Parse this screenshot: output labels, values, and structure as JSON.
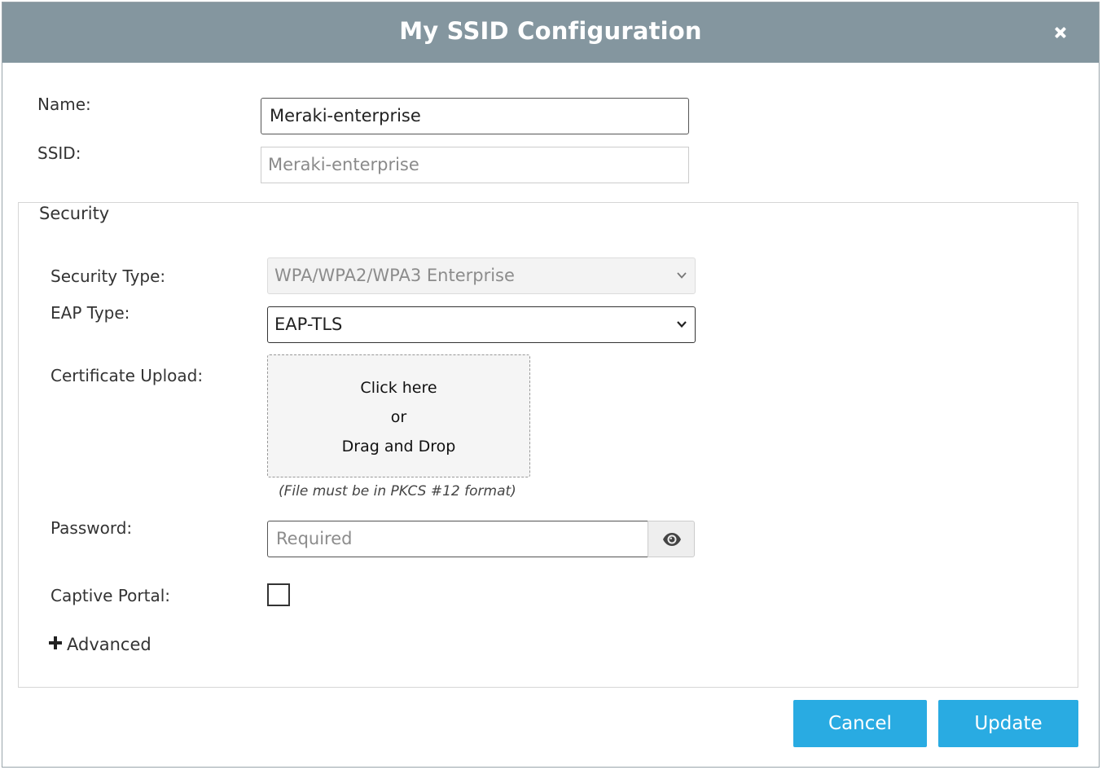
{
  "dialog": {
    "title": "My SSID Configuration",
    "close_icon": "close-icon"
  },
  "form": {
    "name_label": "Name:",
    "name_value": "Meraki-enterprise",
    "ssid_label": "SSID:",
    "ssid_value": "Meraki-enterprise"
  },
  "security": {
    "legend": "Security",
    "security_type_label": "Security Type:",
    "security_type_value": "WPA/WPA2/WPA3 Enterprise",
    "eap_type_label": "EAP Type:",
    "eap_type_value": "EAP-TLS",
    "cert_label": "Certificate Upload:",
    "dropzone": {
      "line1": "Click here",
      "line2": "or",
      "line3": "Drag and Drop"
    },
    "cert_hint": "(File must be in PKCS #12 format)",
    "password_label": "Password:",
    "password_placeholder": "Required",
    "password_toggle_icon": "eye-icon",
    "captive_portal_label": "Captive Portal:",
    "captive_portal_checked": false,
    "advanced_label": "Advanced",
    "advanced_icon": "plus-icon"
  },
  "actions": {
    "cancel_label": "Cancel",
    "update_label": "Update"
  },
  "colors": {
    "header_bg": "#84969f",
    "button_bg": "#29abe2"
  }
}
